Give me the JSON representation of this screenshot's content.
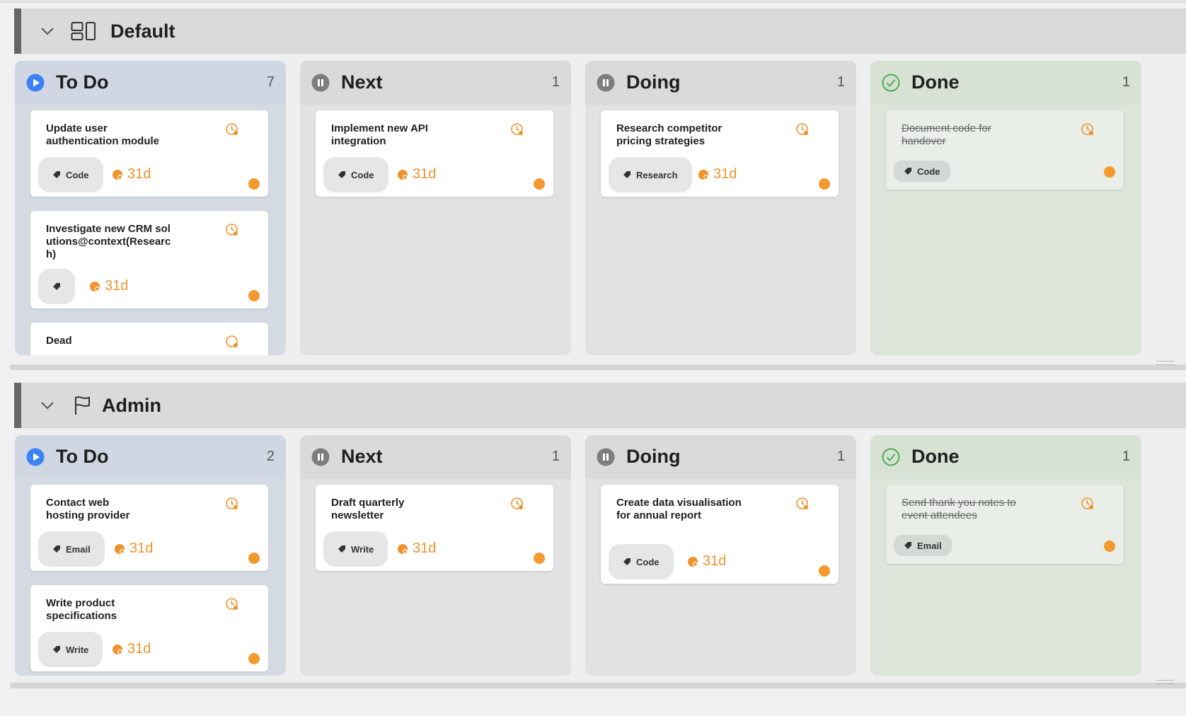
{
  "colors": {
    "accent_blue": "#3b82f6",
    "done_green": "#4caf50",
    "due_orange": "#f0932b",
    "paused_gray": "#808080"
  },
  "groups": [
    {
      "name": "Default",
      "icon": "board-layout-icon",
      "columns": [
        {
          "title": "To Do",
          "count": "7",
          "status_icon": "play-icon",
          "cards": [
            {
              "title": "Update user authentication module",
              "tag": "Code",
              "due": "31d"
            },
            {
              "title": "Investigate new CRM solutions@context(Research)",
              "tag": "",
              "due": "31d"
            },
            {
              "title": "Dead",
              "tag": "",
              "due": ""
            }
          ]
        },
        {
          "title": "Next",
          "count": "1",
          "status_icon": "pause-icon",
          "cards": [
            {
              "title": "Implement new API integration",
              "tag": "Code",
              "due": "31d"
            }
          ]
        },
        {
          "title": "Doing",
          "count": "1",
          "status_icon": "pause-icon",
          "cards": [
            {
              "title": "Research competitor pricing strategies",
              "tag": "Research",
              "due": "31d"
            }
          ]
        },
        {
          "title": "Done",
          "count": "1",
          "status_icon": "check-circle-icon",
          "cards": [
            {
              "title": "Document code for handover",
              "tag": "Code",
              "due": ""
            }
          ]
        }
      ]
    },
    {
      "name": "Admin",
      "icon": "flag-icon",
      "columns": [
        {
          "title": "To Do",
          "count": "2",
          "status_icon": "play-icon",
          "cards": [
            {
              "title": "Contact web hosting provider",
              "tag": "Email",
              "due": "31d"
            },
            {
              "title": "Write product specifications",
              "tag": "Write",
              "due": "31d"
            }
          ]
        },
        {
          "title": "Next",
          "count": "1",
          "status_icon": "pause-icon",
          "cards": [
            {
              "title": "Draft quarterly newsletter",
              "tag": "Write",
              "due": "31d"
            }
          ]
        },
        {
          "title": "Doing",
          "count": "1",
          "status_icon": "pause-icon",
          "cards": [
            {
              "title": "Create data visualisation for annual report",
              "tag": "Code",
              "due": "31d"
            }
          ]
        },
        {
          "title": "Done",
          "count": "1",
          "status_icon": "check-circle-icon",
          "cards": [
            {
              "title": "Send thank you notes to event attendees",
              "tag": "Email",
              "due": ""
            }
          ]
        }
      ]
    }
  ]
}
